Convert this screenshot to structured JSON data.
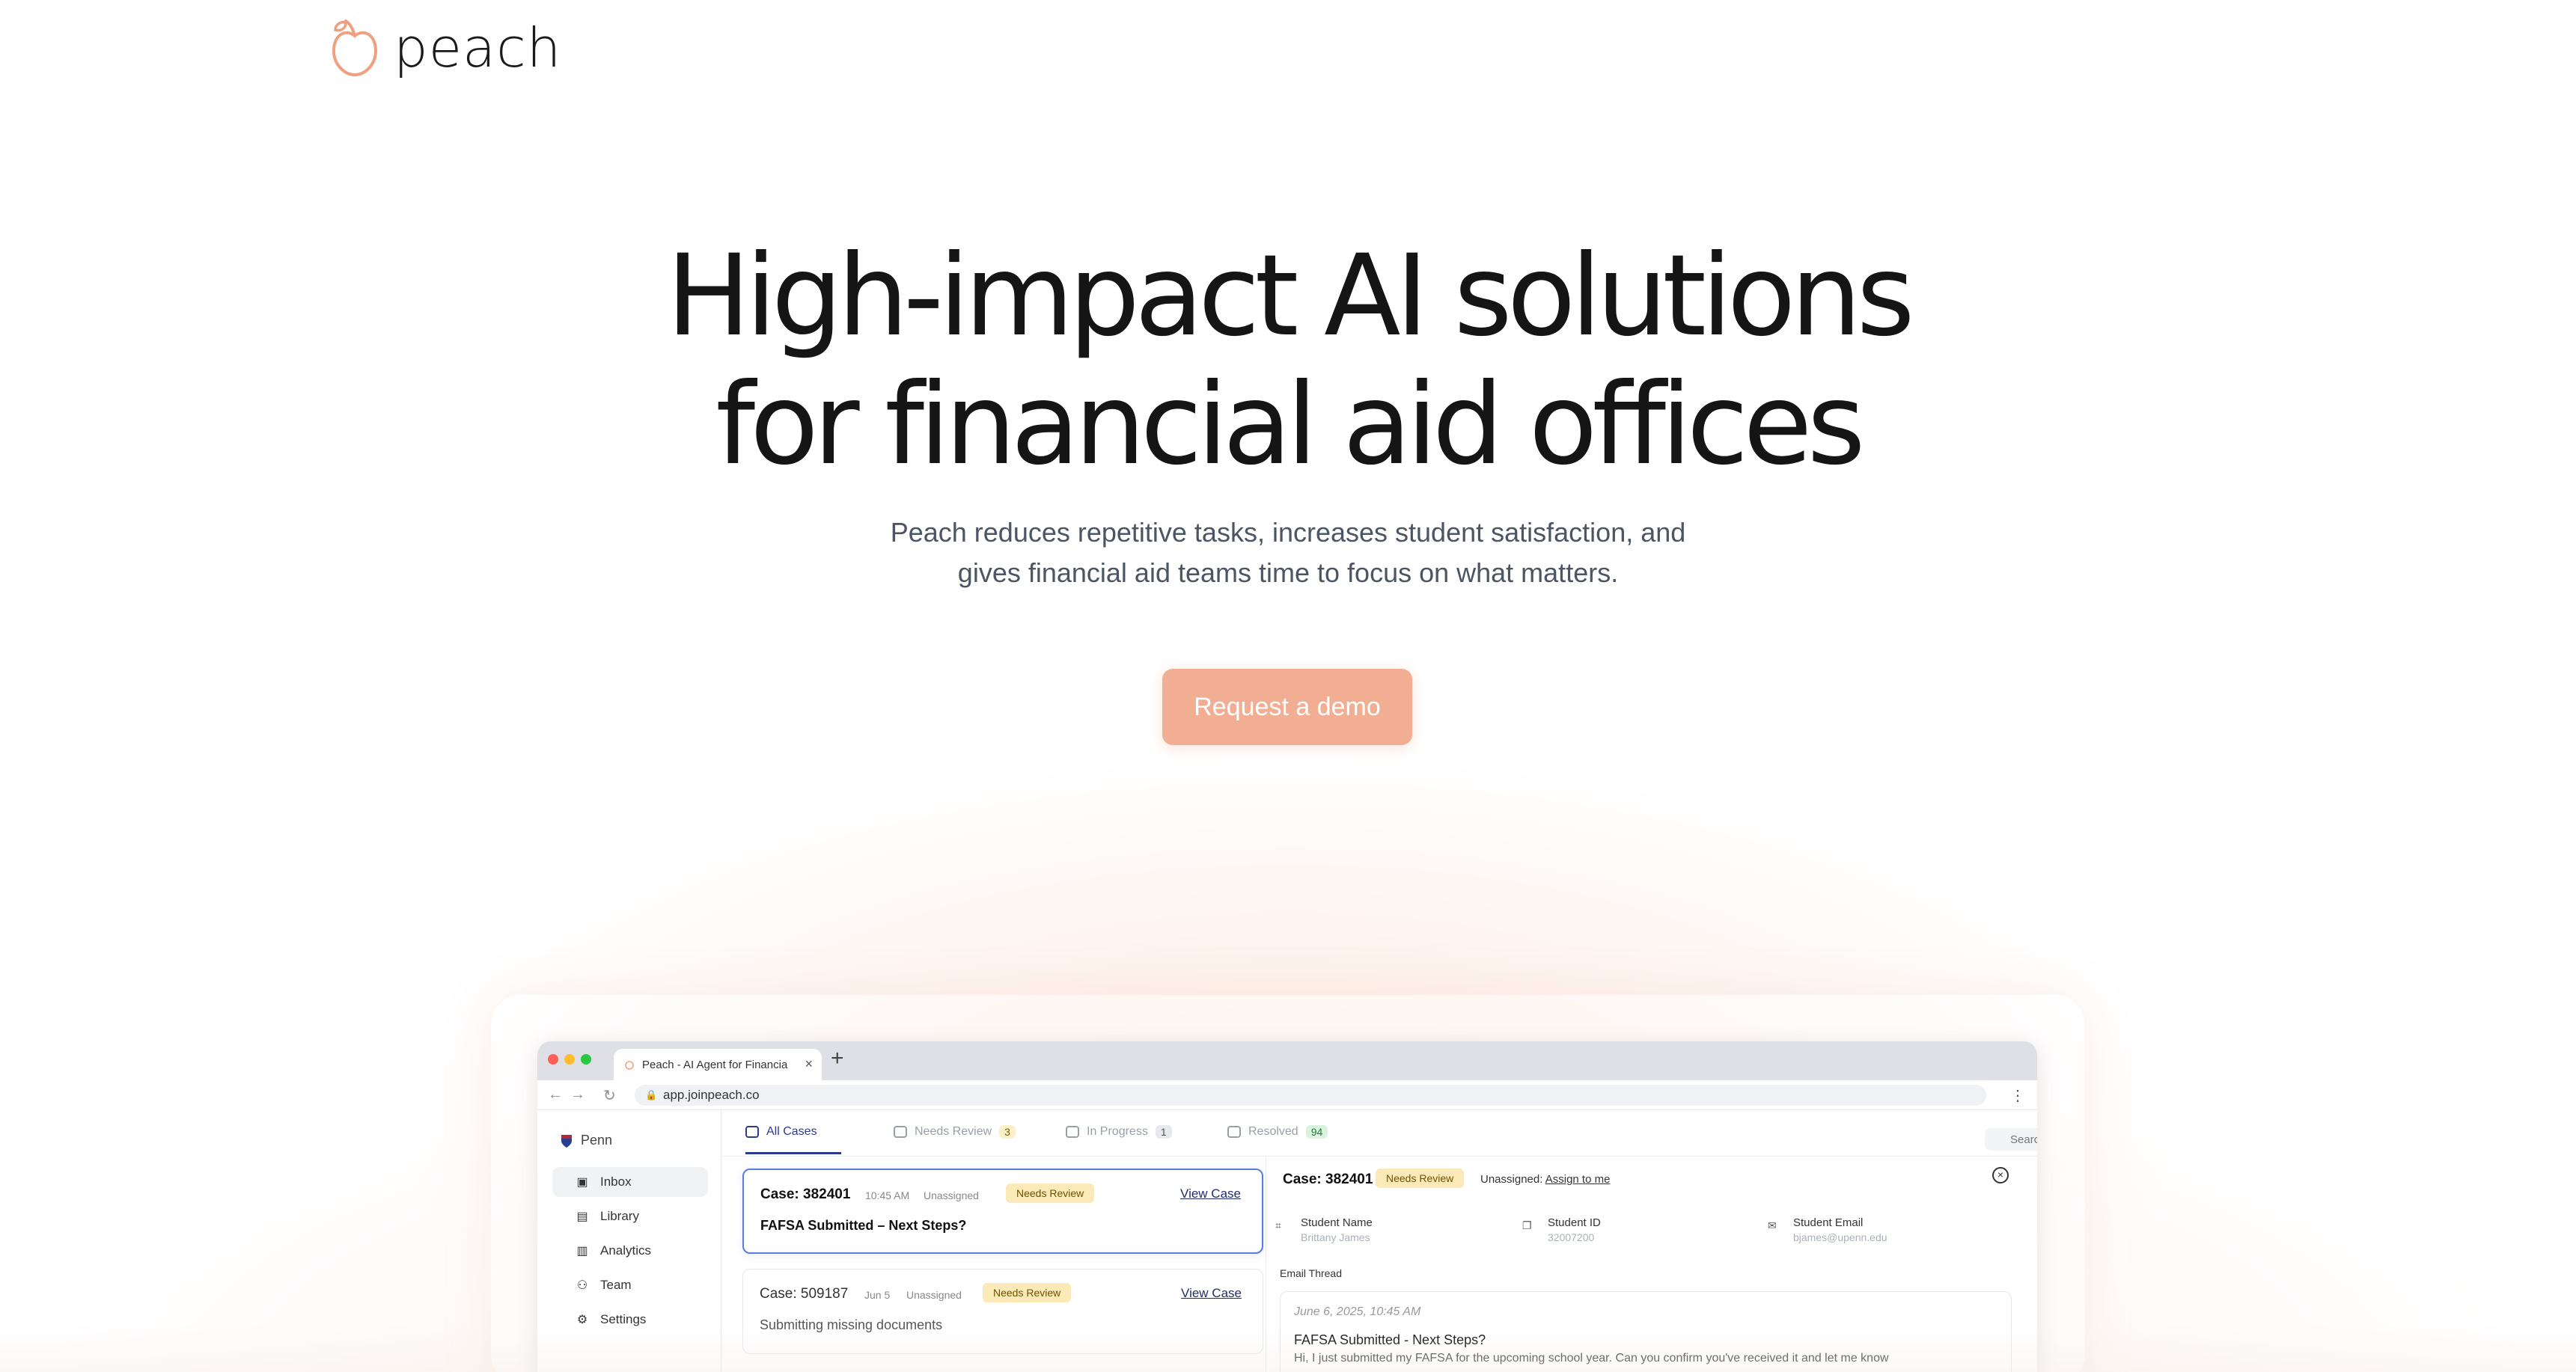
{
  "header": {
    "brand": "peach"
  },
  "hero": {
    "title_line1": "High-impact AI solutions",
    "title_line2": "for financial aid offices",
    "subtitle_line1": "Peach reduces repetitive tasks, increases student satisfaction, and",
    "subtitle_line2": "gives financial aid teams time to focus on what matters.",
    "cta_label": "Request a demo"
  },
  "browser": {
    "tab_title": "Peach - AI Agent for Financia",
    "url": "app.joinpeach.co"
  },
  "app": {
    "org_name": "Penn",
    "sidebar": [
      {
        "label": "Inbox",
        "icon": "inbox-icon",
        "active": true
      },
      {
        "label": "Library",
        "icon": "library-icon"
      },
      {
        "label": "Analytics",
        "icon": "analytics-icon"
      },
      {
        "label": "Team",
        "icon": "team-icon"
      },
      {
        "label": "Settings",
        "icon": "settings-icon"
      }
    ],
    "tabs": [
      {
        "label": "All Cases",
        "count": ""
      },
      {
        "label": "Needs Review",
        "count": "3"
      },
      {
        "label": "In Progress",
        "count": "1"
      },
      {
        "label": "Resolved",
        "count": "94"
      }
    ],
    "search_placeholder": "Search",
    "cases": [
      {
        "id": "Case: 382401",
        "time": "10:45 AM",
        "assignee": "Unassigned",
        "status": "Needs Review",
        "action": "View Case",
        "title": "FAFSA Submitted – Next Steps?"
      },
      {
        "id": "Case: 509187",
        "time": "Jun 5",
        "assignee": "Unassigned",
        "status": "Needs Review",
        "action": "View Case",
        "title": "Submitting missing documents"
      }
    ],
    "detail": {
      "case_id": "Case: 382401",
      "status": "Needs Review",
      "assign_prefix": "Unassigned:",
      "assign_link": "Assign to me",
      "fields": [
        {
          "label": "Student Name",
          "value": "Brittany James"
        },
        {
          "label": "Student ID",
          "value": "32007200"
        },
        {
          "label": "Student Email",
          "value": "bjames@upenn.edu"
        }
      ],
      "thread_label": "Email Thread",
      "thread": {
        "date": "June 6, 2025, 10:45 AM",
        "subject": "FAFSA Submitted - Next Steps?",
        "body": "Hi, I just submitted my FAFSA for the upcoming school year. Can you confirm you've received it and let me know"
      }
    }
  },
  "colors": {
    "accent": "#f2ae93",
    "brand_text": "#1a1a1a",
    "tab_active": "#2d3b8c",
    "pill_bg": "#fbeab8"
  }
}
